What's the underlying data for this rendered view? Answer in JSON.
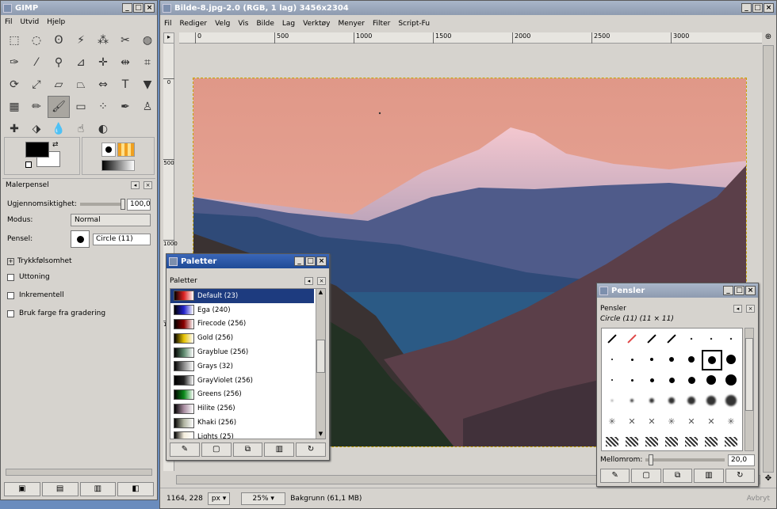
{
  "toolbox": {
    "title": "GIMP",
    "menu": [
      "Fil",
      "Utvid",
      "Hjelp"
    ],
    "tool_icons": [
      "rect-select-icon",
      "ellipse-select-icon",
      "free-select-icon",
      "fuzzy-select-icon",
      "select-by-color-icon",
      "scissors-icon",
      "foreground-select-icon",
      "paths-icon",
      "color-picker-icon",
      "zoom-icon",
      "measure-icon",
      "move-icon",
      "align-icon",
      "crop-icon",
      "rotate-icon",
      "scale-icon",
      "shear-icon",
      "perspective-icon",
      "flip-icon",
      "text-icon",
      "bucket-fill-icon",
      "blend-icon",
      "pencil-icon",
      "paintbrush-icon",
      "eraser-icon",
      "airbrush-icon",
      "ink-icon",
      "clone-icon",
      "heal-icon",
      "perspective-clone-icon",
      "blur-icon",
      "smudge-icon",
      "dodge-burn-icon"
    ],
    "tool_options": {
      "title": "Malerpensel",
      "opacity_label": "Ugjennomsiktighet:",
      "opacity_value": "100,0",
      "mode_label": "Modus:",
      "mode_value": "Normal",
      "brush_label": "Pensel:",
      "brush_value": "Circle (11)",
      "pressure_label": "Trykkfølsomhet",
      "fade_label": "Uttoning",
      "incremental_label": "Inkrementell",
      "gradient_label": "Bruk farge fra gradering"
    }
  },
  "image_window": {
    "title": "Bilde-8.jpg-2.0 (RGB, 1 lag) 3456x2304",
    "menu": [
      "Fil",
      "Rediger",
      "Velg",
      "Vis",
      "Bilde",
      "Lag",
      "Verktøy",
      "Menyer",
      "Filter",
      "Script-Fu"
    ],
    "ruler_h": [
      "0",
      "500",
      "1000",
      "1500",
      "2000",
      "2500",
      "3000"
    ],
    "ruler_v": [
      "0",
      "500",
      "1000",
      "1500"
    ],
    "status": {
      "coords": "1164, 228",
      "unit": "px",
      "zoom": "25%",
      "layer_info": "Bakgrunn (61,1 MB)",
      "cancel": "Avbryt"
    }
  },
  "palettes_window": {
    "title": "Paletter",
    "panel_title": "Paletter",
    "items": [
      {
        "name": "Default (23)",
        "color": "#d22"
      },
      {
        "name": "Ega (240)",
        "color": "#22c"
      },
      {
        "name": "Firecode (256)",
        "color": "#8b0000"
      },
      {
        "name": "Gold (256)",
        "color": "#e6c200"
      },
      {
        "name": "Grayblue (256)",
        "color": "#5e8a6e"
      },
      {
        "name": "Grays (32)",
        "color": "#888888"
      },
      {
        "name": "GrayViolet (256)",
        "color": "#222222"
      },
      {
        "name": "Greens (256)",
        "color": "#0a8a1a"
      },
      {
        "name": "Hilite (256)",
        "color": "#a88ca0"
      },
      {
        "name": "Khaki (256)",
        "color": "#b0b4a0"
      },
      {
        "name": "Lights (25)",
        "color": "#f4eedd"
      }
    ]
  },
  "brushes_window": {
    "title": "Pensler",
    "panel_title": "Pensler",
    "current": "Circle (11) (11 × 11)",
    "spacing_label": "Mellomrom:",
    "spacing_value": "20,0"
  },
  "colors": {
    "titlebar_active": "#2a56a8",
    "window_bg": "#d6d3ce",
    "selection": "#1d3b7f",
    "desktop": "#6a8cbd"
  }
}
